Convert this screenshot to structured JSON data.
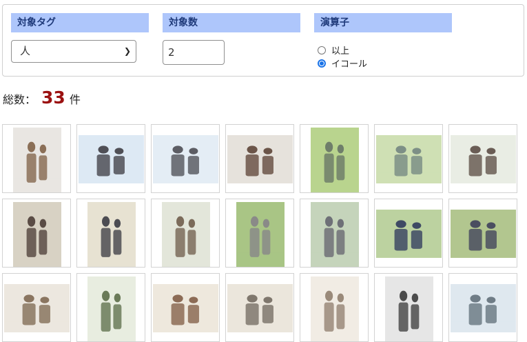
{
  "filters": {
    "tag": {
      "label": "対象タグ",
      "value": "人"
    },
    "count": {
      "label": "対象数",
      "value": "2"
    },
    "operator": {
      "label": "演算子",
      "options": [
        {
          "label": "以上",
          "checked": false
        },
        {
          "label": "イコール",
          "checked": true
        }
      ]
    }
  },
  "summary": {
    "prefix": "総数：",
    "count": "33",
    "unit": "件"
  },
  "thumbnails": [
    {
      "type": "portrait",
      "bg": "#e9e6e2",
      "fg": "#8b6f57"
    },
    {
      "type": "landscape",
      "bg": "#dde9f4",
      "fg": "#4f4f56"
    },
    {
      "type": "landscape",
      "bg": "#e4edf5",
      "fg": "#5c5d64"
    },
    {
      "type": "landscape",
      "bg": "#e6e2dc",
      "fg": "#6b5448"
    },
    {
      "type": "portrait",
      "bg": "#b9d48e",
      "fg": "#6f7e6a"
    },
    {
      "type": "landscape",
      "bg": "#cfe0b4",
      "fg": "#7d8f86"
    },
    {
      "type": "landscape",
      "bg": "#e9ede4",
      "fg": "#6a5d55"
    },
    {
      "type": "portrait",
      "bg": "#d8d2c4",
      "fg": "#5a4c45"
    },
    {
      "type": "portrait",
      "bg": "#e7e2d2",
      "fg": "#4c4c52"
    },
    {
      "type": "portrait",
      "bg": "#e3e6da",
      "fg": "#7b6b5a"
    },
    {
      "type": "portrait",
      "bg": "#a9c585",
      "fg": "#8a8a88"
    },
    {
      "type": "portrait",
      "bg": "#c5d4bb",
      "fg": "#6e7077"
    },
    {
      "type": "landscape",
      "bg": "#bcd2a0",
      "fg": "#3e4a64"
    },
    {
      "type": "landscape",
      "bg": "#b2c68f",
      "fg": "#4a4e60"
    },
    {
      "type": "landscape",
      "bg": "#ece7df",
      "fg": "#8a7560"
    },
    {
      "type": "portrait",
      "bg": "#e8ede0",
      "fg": "#6a7a58"
    },
    {
      "type": "landscape",
      "bg": "#eee8dd",
      "fg": "#8c6b55"
    },
    {
      "type": "landscape",
      "bg": "#ebe6dc",
      "fg": "#7f776d"
    },
    {
      "type": "portrait",
      "bg": "#f1ece4",
      "fg": "#9a8a7a"
    },
    {
      "type": "portrait",
      "bg": "#e6e6e6",
      "fg": "#4c4c4c"
    },
    {
      "type": "landscape",
      "bg": "#dfe8ef",
      "fg": "#6f7c86"
    }
  ]
}
